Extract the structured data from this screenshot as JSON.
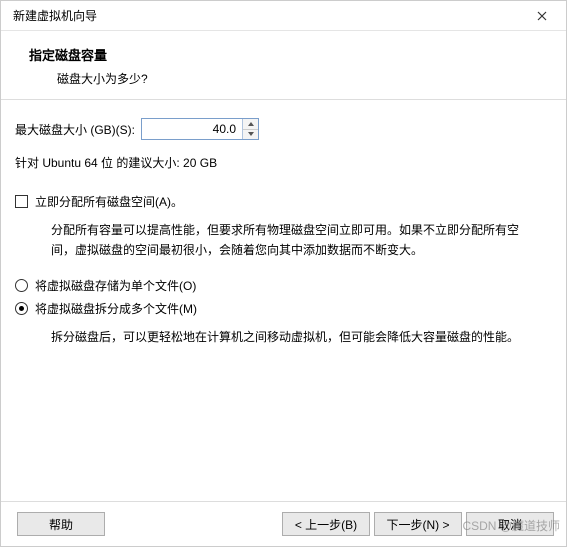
{
  "window": {
    "title": "新建虚拟机向导"
  },
  "header": {
    "title": "指定磁盘容量",
    "subtitle": "磁盘大小为多少?"
  },
  "disk": {
    "size_label": "最大磁盘大小 (GB)(S):",
    "size_value": "40.0",
    "recommend": "针对 Ubuntu 64 位 的建议大小: 20 GB"
  },
  "allocate": {
    "label": "立即分配所有磁盘空间(A)。",
    "desc": "分配所有容量可以提高性能，但要求所有物理磁盘空间立即可用。如果不立即分配所有空间，虚拟磁盘的空间最初很小，会随着您向其中添加数据而不断变大。",
    "checked": false
  },
  "storage": {
    "single_label": "将虚拟磁盘存储为单个文件(O)",
    "split_label": "将虚拟磁盘拆分成多个文件(M)",
    "split_desc": "拆分磁盘后，可以更轻松地在计算机之间移动虚拟机，但可能会降低大容量磁盘的性能。",
    "selected": "split"
  },
  "footer": {
    "help": "帮助",
    "back": "< 上一步(B)",
    "next": "下一步(N) >",
    "cancel": "取消"
  },
  "watermark": "CSDN @魔道技师"
}
